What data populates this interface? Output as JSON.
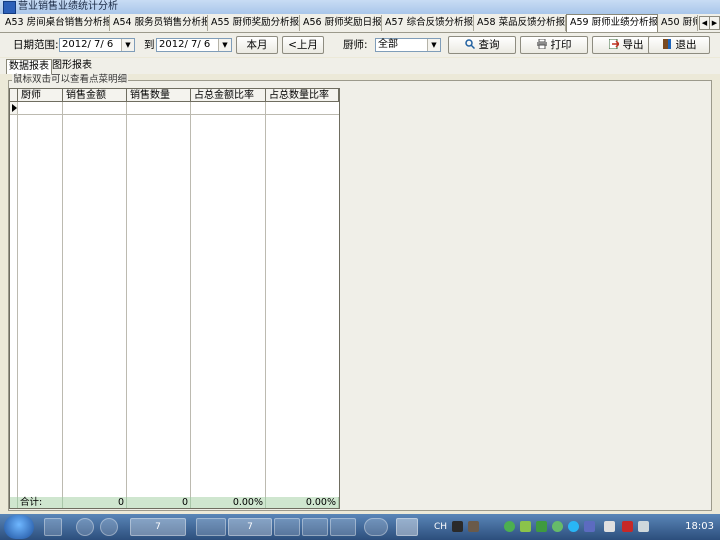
{
  "window": {
    "title": "营业销售业绩统计分析"
  },
  "module_tabs": [
    {
      "label": "A53 房间桌台销售分析报表",
      "active": false
    },
    {
      "label": "A54 服务员销售分析报表",
      "active": false
    },
    {
      "label": "A55 厨师奖励分析报表",
      "active": false
    },
    {
      "label": "A56 厨师奖励日报表",
      "active": false
    },
    {
      "label": "A57 综合反馈分析报表",
      "active": false
    },
    {
      "label": "A58 菜品反馈分析报表",
      "active": false
    },
    {
      "label": "A59 厨师业绩分析报表",
      "active": true
    },
    {
      "label": "A50 厨师",
      "active": false
    }
  ],
  "toolbar": {
    "date_range_label": "日期范围:",
    "date_from": "2012/ 7/ 6",
    "to_label": "到",
    "date_to": "2012/ 7/ 6",
    "this_month": "本月",
    "prev_month": "<上月",
    "chef_label": "厨师:",
    "chef_value": "全部",
    "query": "查询",
    "print": "打印",
    "export": "导出",
    "exit": "退出"
  },
  "sub_tabs": {
    "data": "数据报表",
    "graph": "图形报表"
  },
  "hint": "鼠标双击可以查看点菜明细",
  "table": {
    "columns": [
      "厨师",
      "销售金额",
      "销售数量",
      "占总金额比率",
      "占总数量比率"
    ],
    "totals": {
      "label": "合计:",
      "amount": "0",
      "quantity": "0",
      "amount_ratio": "0.00%",
      "qty_ratio": "0.00%"
    }
  },
  "taskbar": {
    "items": [
      "7",
      "7"
    ],
    "lang": "CH",
    "clock": "18:03"
  }
}
